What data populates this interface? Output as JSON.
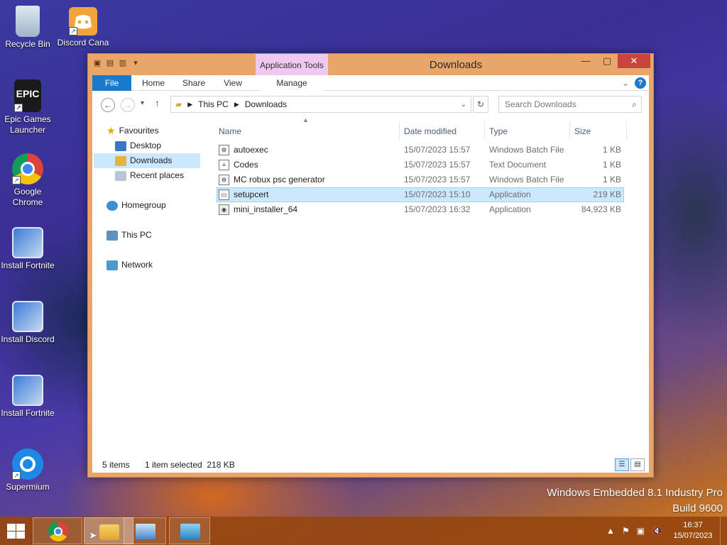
{
  "desktop": {
    "icons": [
      {
        "label": "Recycle Bin"
      },
      {
        "label": "Discord Cana"
      },
      {
        "label": "Epic Games Launcher",
        "logo_text": "EPIC"
      },
      {
        "label": "Google Chrome"
      },
      {
        "label": "Install Fortnite"
      },
      {
        "label": "Install Discord"
      },
      {
        "label": "Install Fortnite"
      },
      {
        "label": "Supermium"
      }
    ]
  },
  "window": {
    "title": "Downloads",
    "context_tab": "Application Tools",
    "ribbon_tabs": [
      "File",
      "Home",
      "Share",
      "View",
      "Manage"
    ],
    "address": {
      "segments": [
        "This PC",
        "Downloads"
      ]
    },
    "search_placeholder": "Search Downloads",
    "nav": {
      "favourites": "Favourites",
      "desktop": "Desktop",
      "downloads": "Downloads",
      "recent": "Recent places",
      "homegroup": "Homegroup",
      "this_pc": "This PC",
      "network": "Network"
    },
    "columns": [
      "Name",
      "Date modified",
      "Type",
      "Size"
    ],
    "files": [
      {
        "name": "autoexec",
        "date": "15/07/2023 15:57",
        "type": "Windows Batch File",
        "size": "1 KB"
      },
      {
        "name": "Codes",
        "date": "15/07/2023 15:57",
        "type": "Text Document",
        "size": "1 KB"
      },
      {
        "name": "MC robux psc generator",
        "date": "15/07/2023 15:57",
        "type": "Windows Batch File",
        "size": "1 KB"
      },
      {
        "name": "setupcert",
        "date": "15/07/2023 15:10",
        "type": "Application",
        "size": "219 KB"
      },
      {
        "name": "mini_installer_64",
        "date": "15/07/2023 16:32",
        "type": "Application",
        "size": "84,923 KB"
      }
    ],
    "status": {
      "items": "5 items",
      "selected": "1 item selected  218 KB"
    }
  },
  "watermark": {
    "line1": "Windows Embedded 8.1 Industry Pro",
    "line2": "Build 9600"
  },
  "taskbar": {
    "time": "16:37",
    "date": "15/07/2023"
  },
  "colors": {
    "accent": "#1979ca",
    "selection": "#cce8ff",
    "window_frame": "#e9a66a",
    "taskbar": "#96460f"
  }
}
